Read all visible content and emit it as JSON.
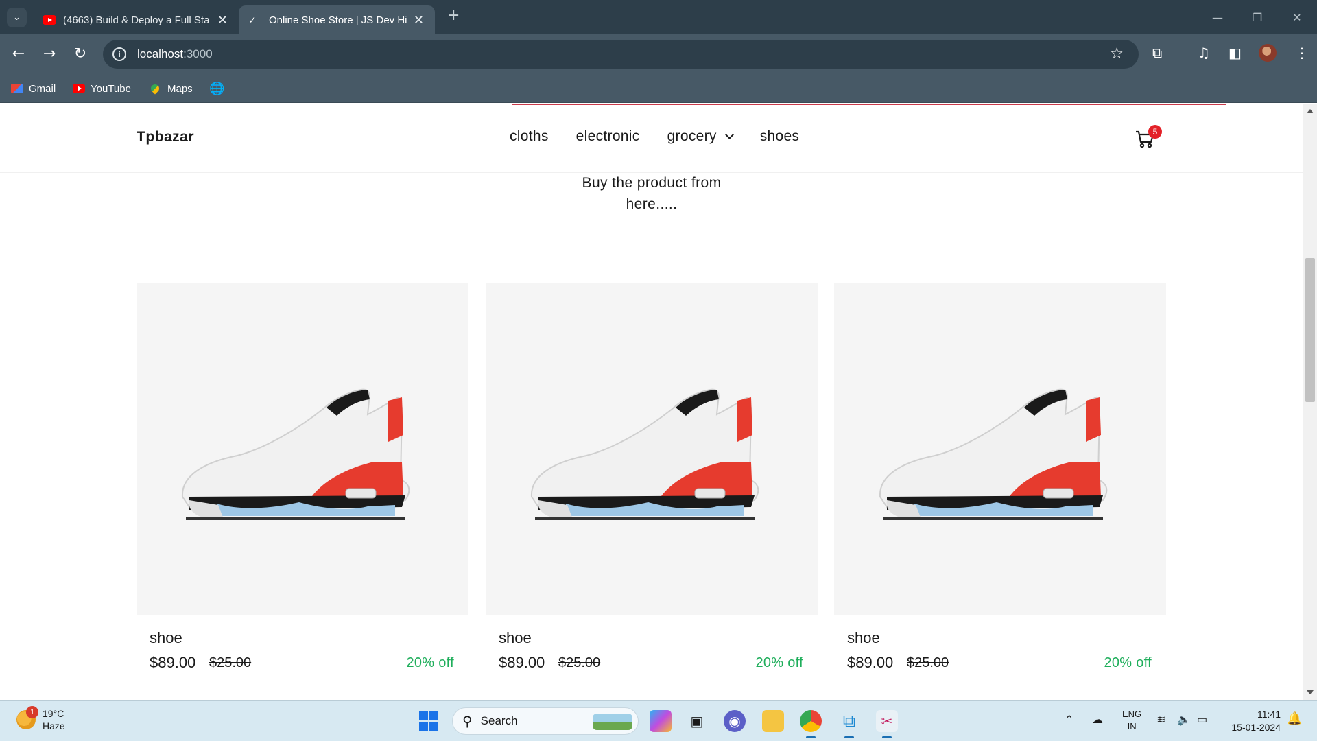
{
  "browser": {
    "tabs": [
      {
        "title": "(4663) Build & Deploy a Full Sta",
        "active": false
      },
      {
        "title": "Online Shoe Store | JS Dev Hind",
        "active": true
      }
    ],
    "url_host": "localhost",
    "url_port": ":3000",
    "bookmarks": [
      "Gmail",
      "YouTube",
      "Maps"
    ]
  },
  "site": {
    "brand": "Tpbazar",
    "menu": [
      "cloths",
      "electronic",
      "grocery",
      "shoes"
    ],
    "cart_count": "5",
    "intro_line1": "Buy the product from",
    "intro_line2": "here....."
  },
  "products": [
    {
      "name": "shoe",
      "price": "$89.00",
      "old_price": "$25.00",
      "discount": "20% off"
    },
    {
      "name": "shoe",
      "price": "$89.00",
      "old_price": "$25.00",
      "discount": "20% off"
    },
    {
      "name": "shoe",
      "price": "$89.00",
      "old_price": "$25.00",
      "discount": "20% off"
    }
  ],
  "taskbar": {
    "weather_temp": "19°C",
    "weather_cond": "Haze",
    "weather_badge": "1",
    "search_label": "Search",
    "lang_line1": "ENG",
    "lang_line2": "IN",
    "time": "11:41",
    "date": "15-01-2024"
  },
  "colors": {
    "chrome_dark": "#2d3e4a",
    "chrome_light": "#475966",
    "discount_green": "#1fae5b",
    "cart_badge_red": "#e32128"
  }
}
